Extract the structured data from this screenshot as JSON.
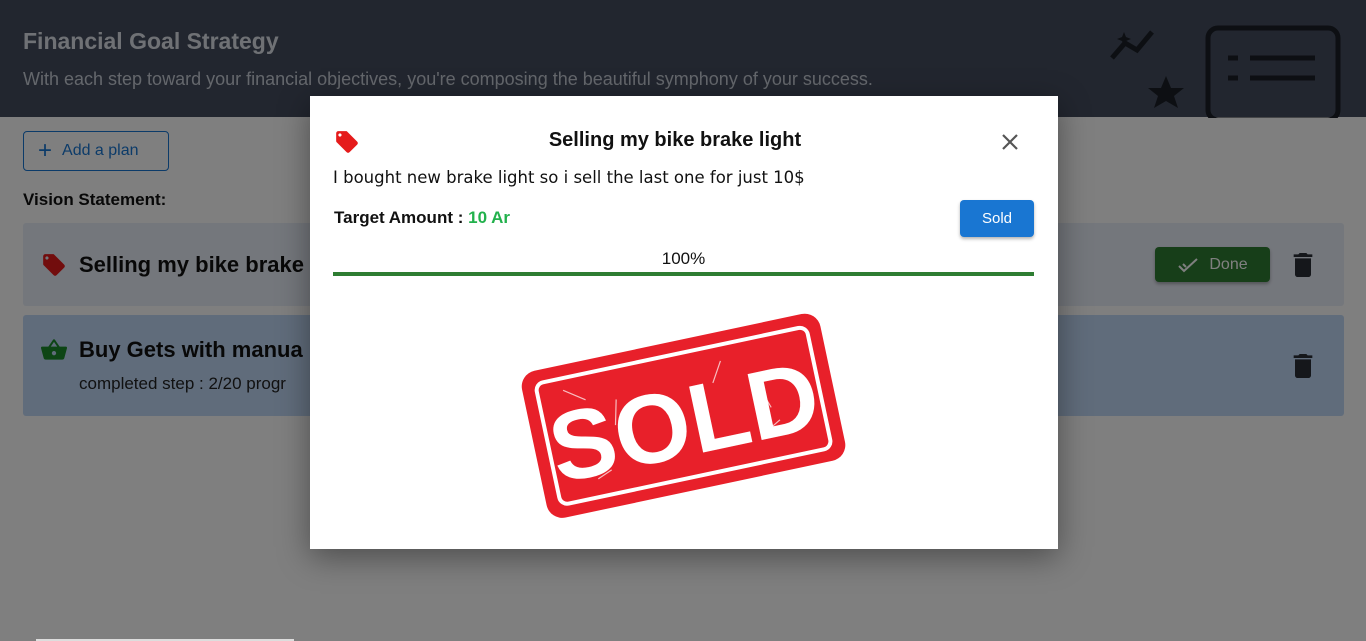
{
  "header": {
    "title": "Financial Goal Strategy",
    "subtitle": "With each step toward your financial objectives, you're composing the beautiful symphony of your success."
  },
  "toolbar": {
    "add_plan_label": "Add a plan"
  },
  "vision_label": "Vision Statement:",
  "plans": [
    {
      "icon": "tag-icon",
      "title": "Selling my bike brake",
      "done_label": "Done",
      "color": "#e9eef8"
    },
    {
      "icon": "basket-icon",
      "title": "Buy Gets with manua",
      "step_text": "completed step : 2/20  progr",
      "color": "#c1d9f7"
    }
  ],
  "modal": {
    "title": "Selling my bike brake light",
    "description": "I bought new brake light so i sell the last one for just 10$",
    "target_label": "Target Amount : ",
    "target_value": "10 Ar",
    "sold_button": "Sold",
    "progress": 1.0,
    "progress_label": "100%",
    "stamp_text": "SOLD"
  },
  "colors": {
    "accent": "#1976d2",
    "success": "#2e7d32",
    "target_value": "#22b14c",
    "stamp_red": "#e8202a"
  }
}
